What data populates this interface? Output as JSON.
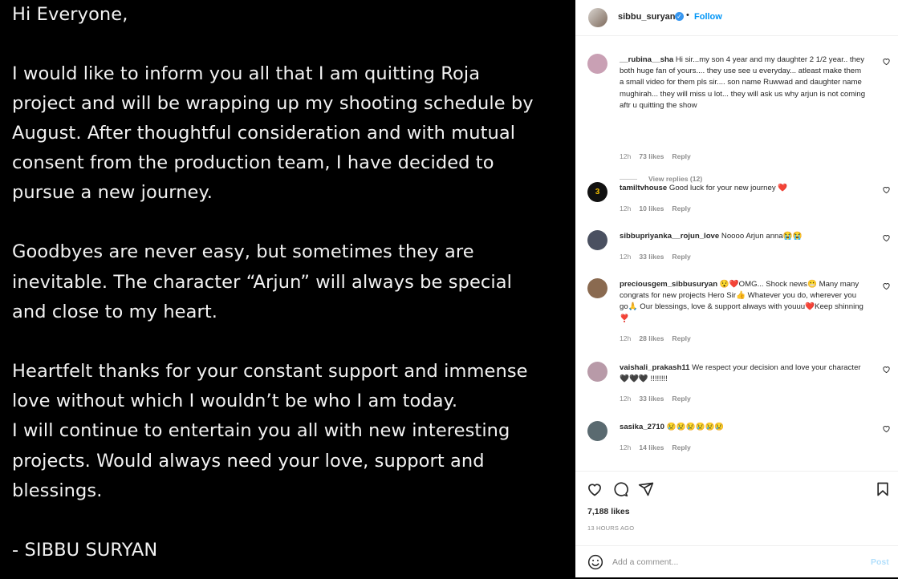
{
  "post_image": {
    "lines": [
      "Hi Everyone,",
      "",
      "I would like to inform you all that I am quitting Roja",
      "project and will be wrapping up my shooting schedule by",
      "August. After thoughtful consideration and with mutual",
      "consent from the production team, I have decided to",
      "pursue a new journey.",
      "",
      "Goodbyes are never easy, but sometimes they are",
      "inevitable. The character “Arjun” will always be special",
      "and close to my heart.",
      "",
      "Heartfelt thanks for your constant support and immense",
      "love without which I wouldn’t be who I am today.",
      "I will continue to entertain you all with new interesting",
      "projects. Would always need your love, support and",
      "blessings.",
      "",
      "- SIBBU SURYAN"
    ]
  },
  "header": {
    "username": "sibbu_suryan",
    "dot": "•",
    "follow_label": "Follow",
    "more_icon": "more-horizontal-icon"
  },
  "comments": [
    {
      "user": "__rubina__sha",
      "text": "Hi sir...my son 4 year and my daughter 2 1/2 year.. they both huge fan of yours.... they use see u everyday... atleast make them a small video for them pls sir.... son name Ruwwad and daughter name mughirah... they will miss u lot... they will ask us why arjun is not coming aftr u quitting the show",
      "time": "12h",
      "likes": "73 likes",
      "reply": "Reply",
      "view_replies": "View replies (12)",
      "avatar_color": "#c9a0b4"
    },
    {
      "user": "tamiltvhouse",
      "text": "Good luck for your new journey ❤️",
      "time": "12h",
      "likes": "10 likes",
      "reply": "Reply",
      "avatar_color": "#111111"
    },
    {
      "user": "sibbupriyanka__rojun_love",
      "text": "Noooo Arjun anna😭😭",
      "time": "12h",
      "likes": "33 likes",
      "reply": "Reply",
      "avatar_color": "#4a5060"
    },
    {
      "user": "preciousgem_sibbusuryan",
      "text": "😯❤️OMG... Shock news😬 Many many congrats for new projects Hero Sir👍 Whatever you do, wherever you go🙏 Our blessings, love & support always with youuu❤️Keep shinning ❣️",
      "time": "12h",
      "likes": "28 likes",
      "reply": "Reply",
      "avatar_color": "#8a6a50"
    },
    {
      "user": "vaishali_prakash11",
      "text": "We respect your decision and love your character 🖤🖤🖤 !!!!!!!!",
      "time": "12h",
      "likes": "33 likes",
      "reply": "Reply",
      "avatar_color": "#b89aa8"
    },
    {
      "user": "sasika_2710",
      "text": "😢😢😢😢😢😢",
      "time": "12h",
      "likes": "14 likes",
      "reply": "Reply",
      "avatar_color": "#5a6a70"
    }
  ],
  "actions": {
    "icons": [
      "heart-icon",
      "comment-icon",
      "share-icon",
      "bookmark-icon"
    ],
    "likes": "7,188 likes",
    "time_ago": "13 HOURS AGO"
  },
  "add_comment": {
    "placeholder": "Add a comment...",
    "post_label": "Post"
  },
  "colors": {
    "accent": "#0095f6",
    "post_disabled": "#b2dffc",
    "heart_red": "#ed4956"
  }
}
